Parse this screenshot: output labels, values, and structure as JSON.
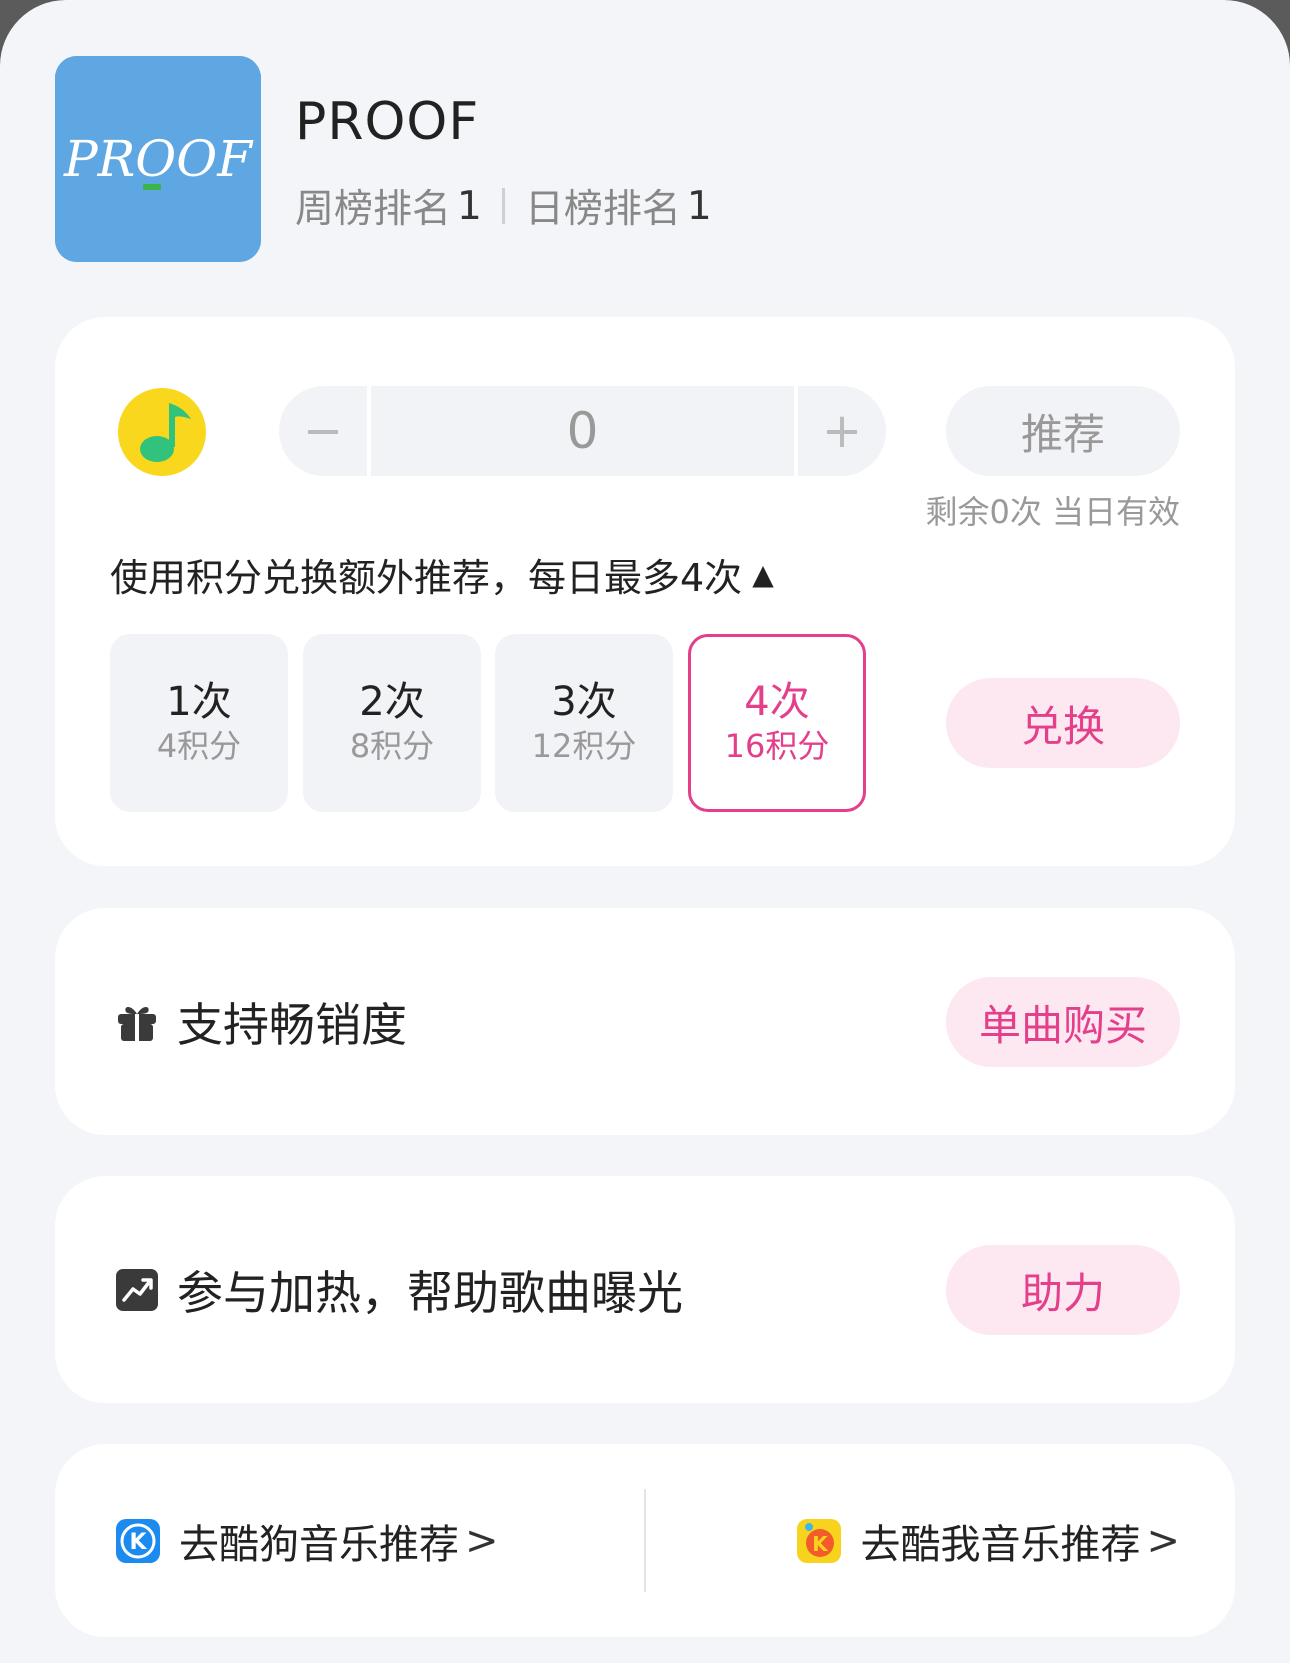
{
  "song": {
    "title": "PROOF",
    "weekly_rank_label": "周榜排名",
    "weekly_rank": "1",
    "daily_rank_label": "日榜排名",
    "daily_rank": "1",
    "cover_text": "PROOF"
  },
  "recommend": {
    "value": "0",
    "minus": "−",
    "plus": "+",
    "button_label": "推荐",
    "remaining": "剩余0次 当日有效",
    "exchange_note": "使用积分兑换额外推荐，每日最多4次",
    "exchange_toggle": "▲",
    "options": [
      {
        "count": "1次",
        "points": "4积分",
        "selected": false
      },
      {
        "count": "2次",
        "points": "8积分",
        "selected": false
      },
      {
        "count": "3次",
        "points": "12积分",
        "selected": false
      },
      {
        "count": "4次",
        "points": "16积分",
        "selected": true
      }
    ],
    "exchange_button": "兑换"
  },
  "support": {
    "label": "支持畅销度",
    "icon": "gift-icon",
    "button": "单曲购买"
  },
  "heat": {
    "label": "参与加热，帮助歌曲曝光",
    "icon": "trend-icon",
    "button": "助力"
  },
  "external": {
    "kugou": {
      "label": "去酷狗音乐推荐",
      "chevron": ">",
      "icon": "kugou-logo-icon"
    },
    "kuwo": {
      "label": "去酷我音乐推荐",
      "chevron": ">",
      "icon": "kuwo-logo-icon"
    }
  },
  "colors": {
    "accent": "#e33f8a",
    "accent_bg": "#fde7f1",
    "cover_bg": "#5ea7e2",
    "page_bg": "#f4f5f9"
  }
}
